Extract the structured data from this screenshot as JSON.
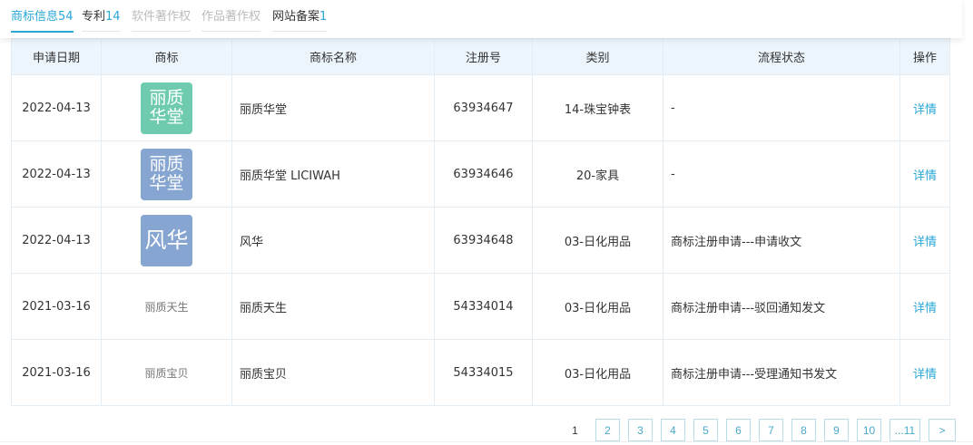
{
  "tabs": [
    {
      "label": "商标信息",
      "count": "54",
      "state": "active"
    },
    {
      "label": "专利",
      "count": "14",
      "state": "normal"
    },
    {
      "label": "软件著作权",
      "count": "",
      "state": "disabled"
    },
    {
      "label": "作品著作权",
      "count": "",
      "state": "disabled"
    },
    {
      "label": "网站备案",
      "count": "1",
      "state": "normal"
    }
  ],
  "table": {
    "headers": [
      "申请日期",
      "商标",
      "商标名称",
      "注册号",
      "类别",
      "流程状态",
      "操作"
    ],
    "rows": [
      {
        "date": "2022-04-13",
        "logo_line1": "丽质",
        "logo_line2": "华堂",
        "logo_color": "#6ecbb0",
        "name": "丽质华堂",
        "reg_no": "63934647",
        "category": "14-珠宝钟表",
        "status": "-",
        "action": "详情"
      },
      {
        "date": "2022-04-13",
        "logo_line1": "丽质",
        "logo_line2": "华堂",
        "logo_color": "#86a5d0",
        "name": "丽质华堂 LICIWAH",
        "reg_no": "63934646",
        "category": "20-家具",
        "status": "-",
        "action": "详情"
      },
      {
        "date": "2022-04-13",
        "logo_line1": "风华",
        "logo_line2": "",
        "logo_color": "#86a5d0",
        "name": "风华",
        "reg_no": "63934648",
        "category": "03-日化用品",
        "status": "商标注册申请---申请收文",
        "action": "详情"
      },
      {
        "date": "2021-03-16",
        "logo_text": "丽质天生",
        "name": "丽质天生",
        "reg_no": "54334014",
        "category": "03-日化用品",
        "status": "商标注册申请---驳回通知发文",
        "action": "详情"
      },
      {
        "date": "2021-03-16",
        "logo_text": "丽质宝贝",
        "name": "丽质宝贝",
        "reg_no": "54334015",
        "category": "03-日化用品",
        "status": "商标注册申请---受理通知书发文",
        "action": "详情"
      }
    ]
  },
  "pagination": {
    "current": "1",
    "pages": [
      "2",
      "3",
      "4",
      "5",
      "6",
      "7",
      "8",
      "9",
      "10",
      "...11"
    ],
    "next": ">"
  }
}
